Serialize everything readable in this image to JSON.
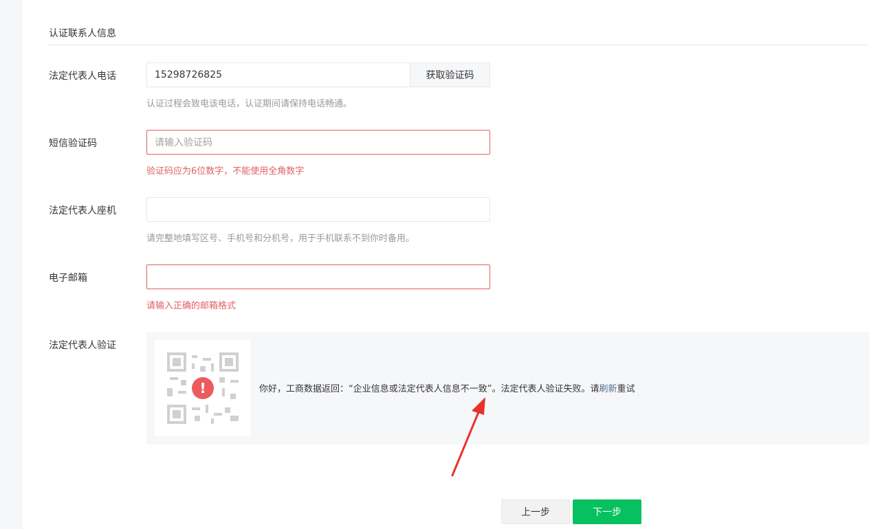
{
  "section": {
    "title": "认证联系人信息"
  },
  "phone": {
    "label": "法定代表人电话",
    "value": "15298726825",
    "button": "获取验证码",
    "tip": "认证过程会致电该电话，认证期间请保持电话畅通。"
  },
  "sms": {
    "label": "短信验证码",
    "placeholder": "请输入验证码",
    "error": "验证码应为6位数字，不能使用全角数字"
  },
  "landline": {
    "label": "法定代表人座机",
    "value": "",
    "tip": "请完整地填写区号、手机号和分机号，用于手机联系不到你时备用。"
  },
  "email": {
    "label": "电子邮箱",
    "value": "",
    "error": "请输入正确的邮箱格式"
  },
  "verify": {
    "label": "法定代表人验证",
    "message": "你好，工商数据返回：“企业信息或法定代表人信息不一致”。法定代表人验证失败。请",
    "retry_link": "刷新",
    "retry_suffix": "重试",
    "icon": "exclamation-icon"
  },
  "footer": {
    "prev_label": "上一步",
    "next_label": "下一步"
  },
  "colors": {
    "accent": "#07c160",
    "error": "#e15f63",
    "link": "#576b95",
    "arrow": "#e8322c"
  }
}
